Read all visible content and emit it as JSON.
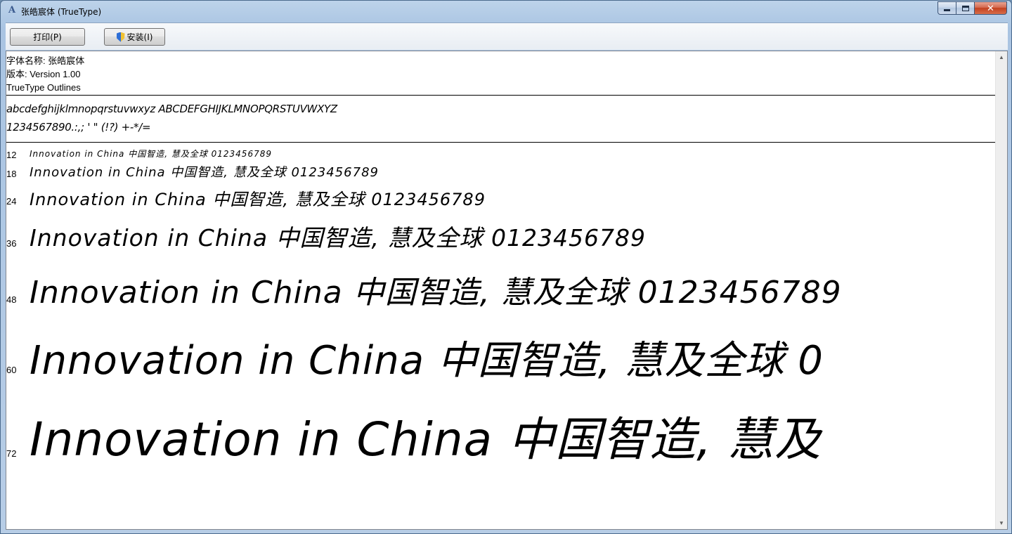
{
  "window": {
    "title": "张皓宸体 (TrueType)",
    "app_icon": "font-file-icon",
    "buttons": {
      "minimize": "minimize",
      "maximize": "maximize",
      "close": "✕"
    }
  },
  "toolbar": {
    "print_label": "打印(P)",
    "install_label": "安装(I)",
    "install_icon": "uac-shield-icon"
  },
  "font_info": {
    "name_line": "字体名称: 张皓宸体",
    "version_line": "版本: Version 1.00",
    "outline_line": "TrueType Outlines"
  },
  "charset": {
    "line1": "abcdefghijklmnopqrstuvwxyz ABCDEFGHIJKLMNOPQRSTUVWXYZ",
    "line2": "1234567890.:,; ' \" (!?) +-*/="
  },
  "samples": [
    {
      "size": "12",
      "text": "Innovation in China 中国智造, 慧及全球 0123456789"
    },
    {
      "size": "18",
      "text": "Innovation in China 中国智造, 慧及全球 0123456789"
    },
    {
      "size": "24",
      "text": "Innovation in China 中国智造, 慧及全球 0123456789"
    },
    {
      "size": "36",
      "text": "Innovation in China 中国智造, 慧及全球 0123456789"
    },
    {
      "size": "48",
      "text": "Innovation in China 中国智造, 慧及全球 0123456789"
    },
    {
      "size": "60",
      "text": "Innovation in China 中国智造, 慧及全球 0"
    },
    {
      "size": "72",
      "text": "Innovation in China 中国智造, 慧及"
    }
  ],
  "scrollbar": {
    "up_arrow": "▲",
    "down_arrow": "▼"
  }
}
